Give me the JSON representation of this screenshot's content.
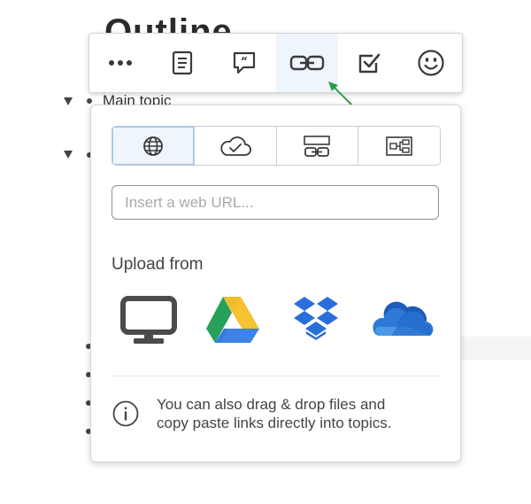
{
  "outline": {
    "title": "Outline",
    "main_topic": "Main topic"
  },
  "toolbar": {
    "items": [
      {
        "name": "more",
        "icon": "more-icon"
      },
      {
        "name": "note",
        "icon": "note-icon"
      },
      {
        "name": "comment",
        "icon": "comment-icon"
      },
      {
        "name": "link",
        "icon": "link-icon",
        "active": true
      },
      {
        "name": "task",
        "icon": "checkbox-icon"
      },
      {
        "name": "emoji",
        "icon": "smiley-icon"
      }
    ]
  },
  "popup": {
    "tabs": [
      {
        "name": "web",
        "icon": "globe-icon",
        "active": true
      },
      {
        "name": "cloud",
        "icon": "cloud-check-icon"
      },
      {
        "name": "topic-link",
        "icon": "topic-link-icon"
      },
      {
        "name": "map-link",
        "icon": "mind-map-icon"
      }
    ],
    "url_placeholder": "Insert a web URL...",
    "url_value": "",
    "upload_heading": "Upload from",
    "sources": [
      {
        "name": "computer",
        "icon": "monitor-icon"
      },
      {
        "name": "google-drive",
        "icon": "google-drive-icon"
      },
      {
        "name": "dropbox",
        "icon": "dropbox-icon"
      },
      {
        "name": "onedrive",
        "icon": "onedrive-icon"
      }
    ],
    "info_line1": "You can also drag & drop files and",
    "info_line2": "copy paste links directly into topics."
  },
  "colors": {
    "accent_active_bg": "#eef5fd",
    "annotation_arrow": "#2e9c4a",
    "dropbox_blue": "#2a6ed9",
    "onedrive_blue": "#2f6fc9"
  }
}
